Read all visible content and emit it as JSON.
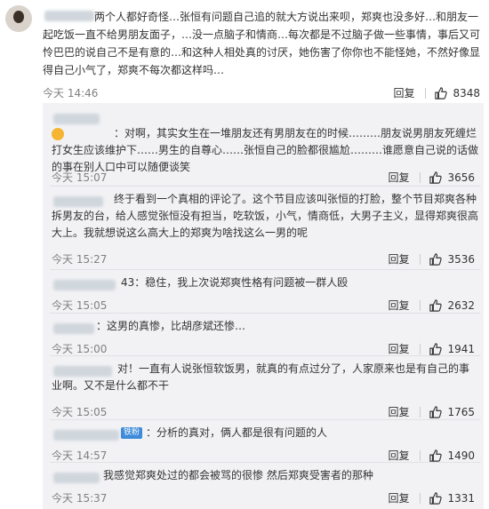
{
  "main_comment": {
    "text": "两个人都好奇怪…张恒有问题自己追的就大方说出来呗，郑爽也没多好…和朋友一起吃饭一直不给男朋友面子，…没一点脑子和情商…每次都是不过脑子做一些事情，事后又可怜巴巴的说自己不是有意的…和这种人相处真的讨厌，她伤害了你你也不能怪她，不然好像显得自己小气了，郑爽不每次都这样吗…",
    "time": "今天 14:46",
    "reply_label": "回复",
    "likes": "8348"
  },
  "replies": [
    {
      "text": "：对啊，其实女生在一堆朋友还有男朋友在的时候………朋友说男朋友死缠烂打女生应该维护下……男生的自尊心……张恒自己的脸都很尴尬………谁愿意自己说的话做的事在别人口中可以随便谈笑",
      "time": "今天 15:07",
      "reply_label": "回复",
      "likes": "3656"
    },
    {
      "text": "终于看到一个真相的评论了。这个节目应该叫张恒的打脸，整个节目郑爽各种拆男友的台，给人感觉张恒没有担当，吃软饭，小气，情商低，大男子主义，显得郑爽很高大上。我就想说这么高大上的郑爽为啥找这么一男的呢",
      "time": "今天 15:27",
      "reply_label": "回复",
      "likes": "3536"
    },
    {
      "text": "43：稳住，我上次说郑爽性格有问题被一群人殴",
      "time": "今天 15:05",
      "reply_label": "回复",
      "likes": "2632"
    },
    {
      "text": "：这男的真惨，比胡彦斌还惨…",
      "time": "今天 15:00",
      "reply_label": "回复",
      "likes": "1941"
    },
    {
      "text": "对！一直有人说张恒软饭男，就真的有点过分了，人家原来也是有自己的事业啊。又不是什么都不干",
      "time": "今天 15:05",
      "reply_label": "回复",
      "likes": "1765"
    },
    {
      "text": "：分析的真对，俩人都是很有问题的人",
      "badge": "铁粉",
      "time": "今天 14:57",
      "reply_label": "回复",
      "likes": "1490"
    },
    {
      "text": "我感觉郑爽处过的都会被骂的很惨 然后郑爽受害者的那种",
      "time": "今天 15:37",
      "reply_label": "回复",
      "likes": "1331"
    }
  ]
}
